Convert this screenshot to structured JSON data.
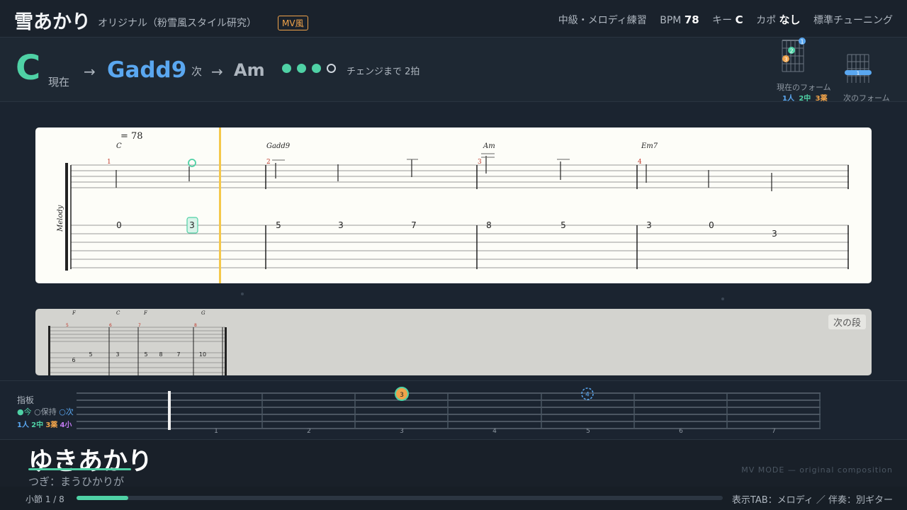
{
  "header": {
    "song_title": "雪あかり",
    "subtitle": "オリジナル（粉雪風スタイル研究）",
    "badge": "MV風",
    "level": "中級・メロディ練習",
    "bpm_label": "BPM",
    "bpm_value": "78",
    "key_label": "キー",
    "key_value": "C",
    "capo_label": "カポ",
    "capo_value": "なし",
    "tuning": "標準チューニング"
  },
  "chords": {
    "current": "C",
    "current_label": "現在",
    "arrow": "→",
    "next": "Gadd9",
    "next_label": "次",
    "after": "Am",
    "beats_done": 3,
    "beats_total": 4,
    "change_text": "チェンジまで 2拍",
    "current_form_label": "現在のフォーム",
    "next_form_label": "次のフォーム",
    "finger_legend": [
      "1人",
      "2中",
      "3薬"
    ],
    "current_form_fingers": [
      "1",
      "2",
      "3"
    ],
    "next_form_fingers": [
      "1"
    ]
  },
  "score": {
    "tempo": "= 78",
    "track_label": "Melody",
    "chords": [
      "C",
      "Gadd9",
      "Am",
      "Em7"
    ],
    "measure_numbers": [
      "1",
      "2",
      "3",
      "4"
    ],
    "tab_numbers": [
      "0",
      "3",
      "5",
      "3",
      "7",
      "8",
      "5",
      "3",
      "0",
      "3"
    ]
  },
  "preview": {
    "next_button": "次の段",
    "chords": [
      "F",
      "C",
      "F",
      "G"
    ],
    "measure_numbers": [
      "5",
      "6",
      "7",
      "8"
    ],
    "tab_numbers": [
      "6",
      "5",
      "3",
      "5",
      "8",
      "7",
      "10"
    ]
  },
  "fretboard": {
    "title": "指板",
    "legend_now": "●今",
    "legend_hold": "○保持",
    "legend_next": "○次",
    "finger_legend": [
      "1人",
      "2中",
      "3薬",
      "4小"
    ],
    "fret_numbers": [
      "1",
      "2",
      "3",
      "4",
      "5",
      "6",
      "7"
    ],
    "current_marker": "3",
    "next_marker": "4"
  },
  "lyrics": {
    "current": "ゆきあかり",
    "next": "つぎ：まうひかりが",
    "mv_mode": "MV MODE — original composition"
  },
  "footer": {
    "measure": "小節 1 / 8",
    "progress": 0.08,
    "display": "表示TAB：メロディ ／ 伴奏：別ギター"
  },
  "colors": {
    "accent": "#4fd1a5",
    "blue": "#5aa7f0",
    "orange": "#f0a34a",
    "purple": "#c079f0",
    "playhead": "#f5c84a"
  }
}
